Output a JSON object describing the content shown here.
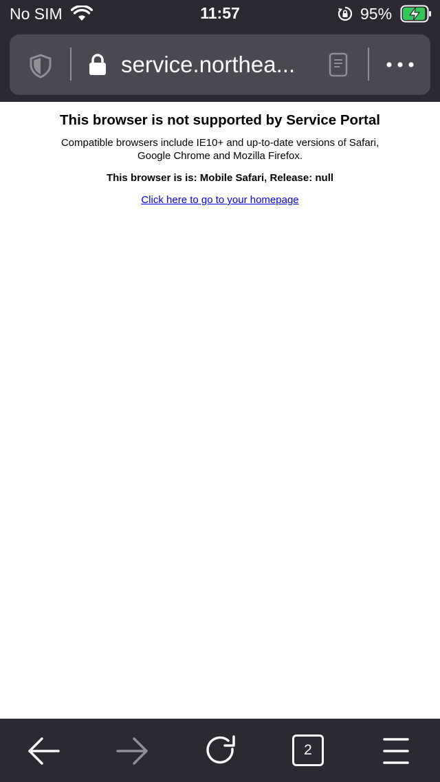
{
  "status_bar": {
    "carrier": "No SIM",
    "time": "11:57",
    "battery_percent": "95%",
    "battery_level": 0.95,
    "charging": true,
    "icons": [
      "wifi-icon",
      "rotation-lock-icon",
      "battery-charging-icon"
    ]
  },
  "toolbar_top": {
    "url": "service.northea...",
    "icons": [
      "tracking-shield-icon",
      "lock-icon",
      "reader-mode-icon",
      "more-icon"
    ]
  },
  "page": {
    "title": "This browser is not supported by Service Portal",
    "compat_line1": "Compatible browsers include IE10+ and up-to-date versions of Safari,",
    "compat_line2": "Google Chrome and Mozilla Firefox.",
    "browser_info": "This browser is is: Mobile Safari, Release: null",
    "homepage_link": "Click here to go to your homepage"
  },
  "toolbar_bottom": {
    "tab_count": "2",
    "icons": [
      "back-arrow-icon",
      "forward-arrow-icon",
      "reload-icon",
      "tabs-icon",
      "menu-icon"
    ]
  },
  "colors": {
    "chrome_bg": "#2b2a33",
    "url_bar_bg": "#4a4951",
    "battery_green": "#34c759",
    "link": "#0000ee"
  }
}
